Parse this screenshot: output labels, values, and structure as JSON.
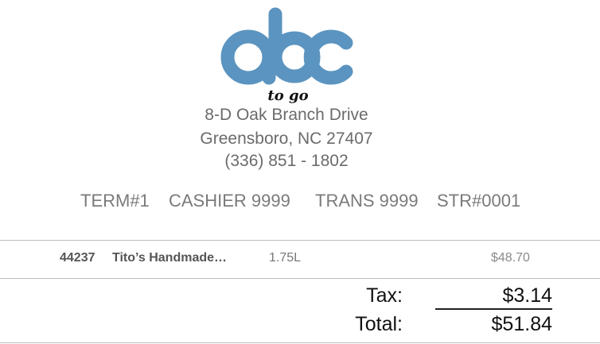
{
  "store": {
    "logo_subtitle": "to go",
    "address_line1": "8-D  Oak Branch Drive",
    "address_line2": "Greensboro, NC 27407",
    "phone": "(336) 851 - 1802",
    "brand_color": "#5b94c0"
  },
  "meta": {
    "terminal": "TERM#1",
    "cashier": "CASHIER  9999",
    "transaction": "TRANS 9999",
    "store_number": "STR#0001"
  },
  "items": [
    {
      "sku": "44237",
      "name": "Tito’s Handmade…",
      "size": "1.75L",
      "price": "$48.70"
    }
  ],
  "totals": {
    "tax_label": "Tax:",
    "tax_value": "$3.14",
    "total_label": "Total:",
    "total_value": "$51.84"
  }
}
